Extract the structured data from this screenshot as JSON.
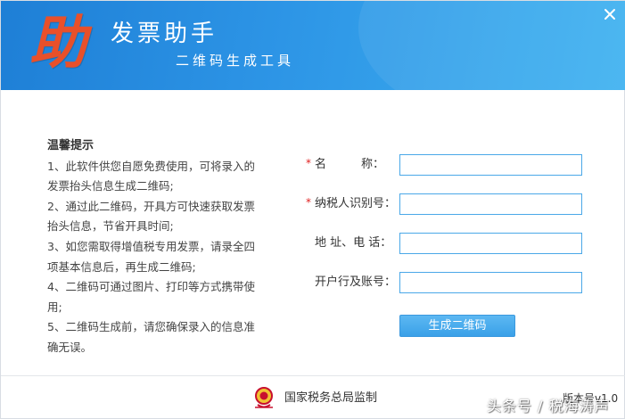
{
  "header": {
    "logo_char": "助",
    "title": "发票助手",
    "subtitle": "二维码生成工具",
    "close_icon": "close-icon"
  },
  "tips": {
    "title": "温馨提示",
    "items": [
      "1、此软件供您自愿免费使用，可将录入的发票抬头信息生成二维码;",
      "2、通过此二维码，开具方可快速获取发票抬头信息，节省开具时间;",
      "3、如您需取得增值税专用发票，请录全四项基本信息后，再生成二维码;",
      "4、二维码可通过图片、打印等方式携带使用;",
      "5、二维码生成前，请您确保录入的信息准确无误。"
    ]
  },
  "form": {
    "required_mark": "*",
    "fields": [
      {
        "label": "名　　　称：",
        "value": "",
        "required": true
      },
      {
        "label": "纳税人识别号：",
        "value": "",
        "required": true
      },
      {
        "label": "地 址、电 话：",
        "value": "",
        "required": false
      },
      {
        "label": "开户行及账号：",
        "value": "",
        "required": false
      }
    ],
    "generate_label": "生成二维码"
  },
  "footer": {
    "supervision": "国家税务总局监制",
    "version": "版本号v1.0",
    "watermark": "头条号 / 税海涛声"
  },
  "colors": {
    "header_start": "#1e7fd6",
    "header_end": "#3fb2f0",
    "logo": "#e8502a",
    "accent": "#3aa0e8",
    "required": "#e02020"
  }
}
